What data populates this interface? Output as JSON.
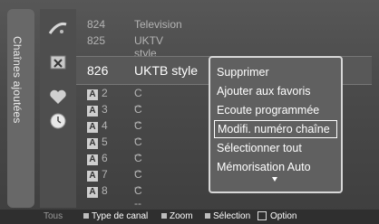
{
  "sidebar": {
    "tab_label": "Chaînes ajoutées"
  },
  "icons": [
    {
      "name": "satellite-icon"
    },
    {
      "name": "tools-icon"
    },
    {
      "name": "heart-icon"
    },
    {
      "name": "clock-icon"
    }
  ],
  "channels": [
    {
      "num": "824",
      "name": "Television"
    },
    {
      "num": "825",
      "name": "UKTV style"
    },
    {
      "num": "826",
      "name": "UKTB style"
    },
    {
      "badge": "A",
      "num": "2",
      "name": "C --"
    },
    {
      "badge": "A",
      "num": "3",
      "name": "C --"
    },
    {
      "badge": "A",
      "num": "4",
      "name": "C --"
    },
    {
      "badge": "A",
      "num": "5",
      "name": "C --"
    },
    {
      "badge": "A",
      "num": "6",
      "name": "C --"
    },
    {
      "badge": "A",
      "num": "7",
      "name": "C --"
    },
    {
      "badge": "A",
      "num": "8",
      "name": "C --"
    }
  ],
  "popup_menu": {
    "items": [
      "Supprimer",
      "Ajouter aux favoris",
      "Ecoute programmée",
      "Modifi. numéro chaîne",
      "Sélectionner tout",
      "Mémorisation Auto"
    ],
    "active_index": 3
  },
  "footer": {
    "tous": "Tous",
    "items": [
      "Type de canal",
      "Zoom",
      "Sélection",
      "Option"
    ]
  }
}
